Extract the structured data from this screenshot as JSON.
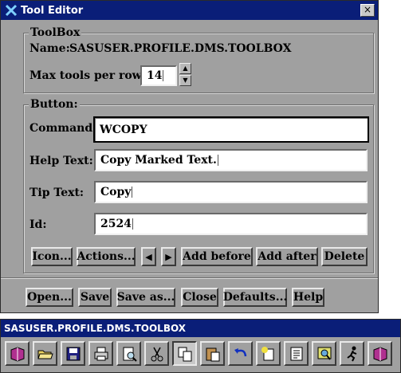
{
  "window": {
    "title": "Tool Editor",
    "close_label": "×"
  },
  "toolbox": {
    "group_label": "ToolBox",
    "name_label": "Name:",
    "name_value": "SASUSER.PROFILE.DMS.TOOLBOX",
    "max_label": "Max tools per row:",
    "max_value": "14"
  },
  "button_group": {
    "group_label": "Button:",
    "command_label": "Command:",
    "command_value": "WCOPY",
    "help_label": "Help Text:",
    "help_value": "Copy Marked Text.",
    "tip_label": "Tip Text:",
    "tip_value": "Copy",
    "id_label": "Id:",
    "id_value": "2524",
    "icon_btn": "Icon...",
    "actions_btn": "Actions...",
    "prev_arrow": "◀",
    "next_arrow": "▶",
    "add_before": "Add before",
    "add_after": "Add after",
    "delete": "Delete"
  },
  "footer": {
    "open": "Open...",
    "save": "Save",
    "save_as": "Save as...",
    "close": "Close",
    "defaults": "Defaults...",
    "help": "Help"
  },
  "toolbar_window": {
    "title": "SASUSER.PROFILE.DMS.TOOLBOX",
    "tools": [
      "book-icon",
      "open-folder-icon",
      "save-disk-icon",
      "print-icon",
      "print-preview-icon",
      "cut-icon",
      "copy-icon",
      "paste-icon",
      "undo-icon",
      "new-icon",
      "form-icon",
      "find-icon",
      "run-icon",
      "help-book-icon"
    ]
  }
}
